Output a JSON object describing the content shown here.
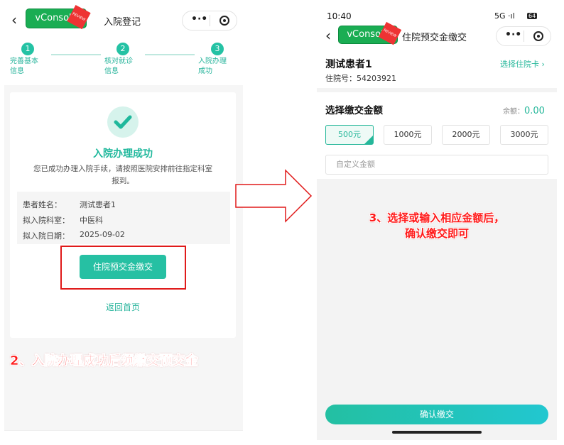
{
  "left": {
    "nav": {
      "back_icon": "chevron-left-icon",
      "vconsole": "vConsole",
      "vconsole_tag": "REVIEW",
      "title": "入院登记",
      "more_icon": "more-dots-icon",
      "close_icon": "target-icon"
    },
    "steps": [
      {
        "num": "1",
        "label1": "完善基本",
        "label2": "信息"
      },
      {
        "num": "2",
        "label1": "核对就诊",
        "label2": "信息"
      },
      {
        "num": "3",
        "label1": "入院办理",
        "label2": "成功"
      }
    ],
    "result": {
      "icon": "check-icon",
      "title": "入院办理成功",
      "desc1": "您已成功办理入院手续，请按照医院安排前往指定科室",
      "desc2": "报到。"
    },
    "info": [
      {
        "label": "患者姓名：",
        "value": "测试患者1"
      },
      {
        "label": "拟入院科室：",
        "value": "中医科"
      },
      {
        "label": "拟入院日期：",
        "value": "2025-09-02"
      }
    ],
    "pay_button": "住院预交金缴交",
    "home_link": "返回首页",
    "caption": "2、入院办理成功后须缴交预交金"
  },
  "right": {
    "status": {
      "time": "10:40",
      "network": "5G",
      "battery": "64"
    },
    "nav": {
      "back_icon": "chevron-left-icon",
      "vconsole": "vConsole",
      "vconsole_tag": "REVIEW",
      "title": "住院预交金缴交"
    },
    "patient": {
      "name": "测试患者1",
      "id_label": "住院号：",
      "id_value": "54203921",
      "select_card": "选择住院卡"
    },
    "amount": {
      "title": "选择缴交金额",
      "balance_label": "余额：",
      "balance_value": "0.00",
      "options": [
        "500元",
        "1000元",
        "2000元",
        "3000元"
      ],
      "selected": "500元",
      "custom_placeholder": "自定义金额"
    },
    "caption_line1": "3、选择或输入相应金额后，",
    "caption_line2": "确认缴交即可",
    "confirm_button": "确认缴交"
  },
  "colors": {
    "accent": "#25b79a",
    "highlight": "#e01a1a",
    "vconsole": "#1aad53"
  }
}
